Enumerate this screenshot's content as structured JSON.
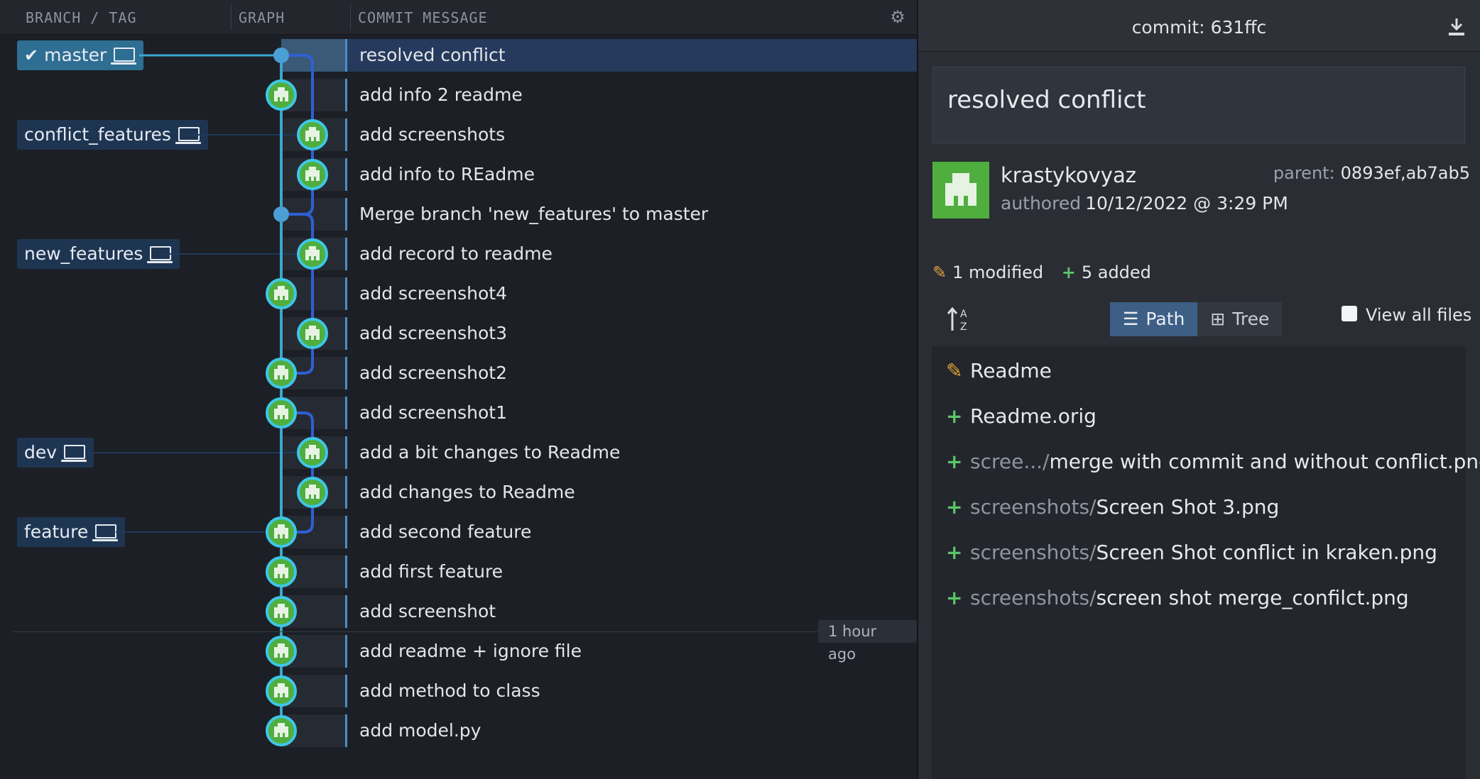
{
  "columns": {
    "branch_tag": "BRANCH / TAG",
    "graph": "GRAPH",
    "message": "COMMIT MESSAGE"
  },
  "icons": {
    "settings": "gear-icon",
    "branch": "laptop-icon",
    "current": "checkmark-icon",
    "download": "download-icon",
    "modified": "pencil-icon",
    "added": "plus-icon"
  },
  "colors": {
    "accent": "#3d5f86",
    "node_green": "#4fae3e",
    "node_ring": "#3ec7e6",
    "lane_cyan": "#3aa6d0",
    "lane_blue": "#2f5fd6",
    "modified": "#e0a23a",
    "added": "#5cc46b"
  },
  "branches": [
    {
      "name": "master",
      "current": true,
      "row": 0
    },
    {
      "name": "conflict_features",
      "current": false,
      "row": 2
    },
    {
      "name": "new_features",
      "current": false,
      "row": 5
    },
    {
      "name": "dev",
      "current": false,
      "row": 10
    },
    {
      "name": "feature",
      "current": false,
      "row": 12
    }
  ],
  "commits": [
    {
      "message": "resolved conflict",
      "selected": true,
      "lane": 0,
      "merge": true
    },
    {
      "message": "add info 2 readme",
      "lane": 0
    },
    {
      "message": "add screenshots",
      "lane": 1
    },
    {
      "message": "add info to REadme",
      "lane": 1
    },
    {
      "message": "Merge branch 'new_features' to master",
      "lane": 0,
      "merge": true
    },
    {
      "message": "add record to readme",
      "lane": 1
    },
    {
      "message": "add screenshot4",
      "lane": 0
    },
    {
      "message": "add screenshot3",
      "lane": 1
    },
    {
      "message": "add screenshot2",
      "lane": 0
    },
    {
      "message": "add screenshot1",
      "lane": 0
    },
    {
      "message": "add a bit changes to Readme",
      "lane": 1
    },
    {
      "message": "add changes to Readme",
      "lane": 1
    },
    {
      "message": "add second feature",
      "lane": 0
    },
    {
      "message": "add first feature",
      "lane": 0
    },
    {
      "message": "add screenshot",
      "lane": 0
    },
    {
      "message": "add readme + ignore file",
      "lane": 0
    },
    {
      "message": "add method to class",
      "lane": 0
    },
    {
      "message": "add model.py",
      "lane": 0
    }
  ],
  "time_marker": {
    "label": "1 hour ago"
  },
  "details": {
    "commit_label": "commit:",
    "commit_sha": "631ffc",
    "summary": "resolved conflict",
    "author": "krastykovyaz",
    "authored_label": "authored",
    "authored_date": "10/12/2022 @ 3:29 PM",
    "parent_label": "parent:",
    "parent_value": "0893ef,ab7ab5",
    "modified_count": "1 modified",
    "added_count": "5 added",
    "view_path": "Path",
    "view_tree": "Tree",
    "view_all": "View all files",
    "files": [
      {
        "status": "modified",
        "dir": "",
        "name": "Readme"
      },
      {
        "status": "added",
        "dir": "",
        "name": "Readme.orig"
      },
      {
        "status": "added",
        "dir": "scree.../",
        "name": "merge with commit and without conflict.png"
      },
      {
        "status": "added",
        "dir": "screenshots/",
        "name": "Screen Shot 3.png"
      },
      {
        "status": "added",
        "dir": "screenshots/",
        "name": "Screen Shot conflict in kraken.png"
      },
      {
        "status": "added",
        "dir": "screenshots/",
        "name": "screen shot merge_confilct.png"
      }
    ]
  }
}
